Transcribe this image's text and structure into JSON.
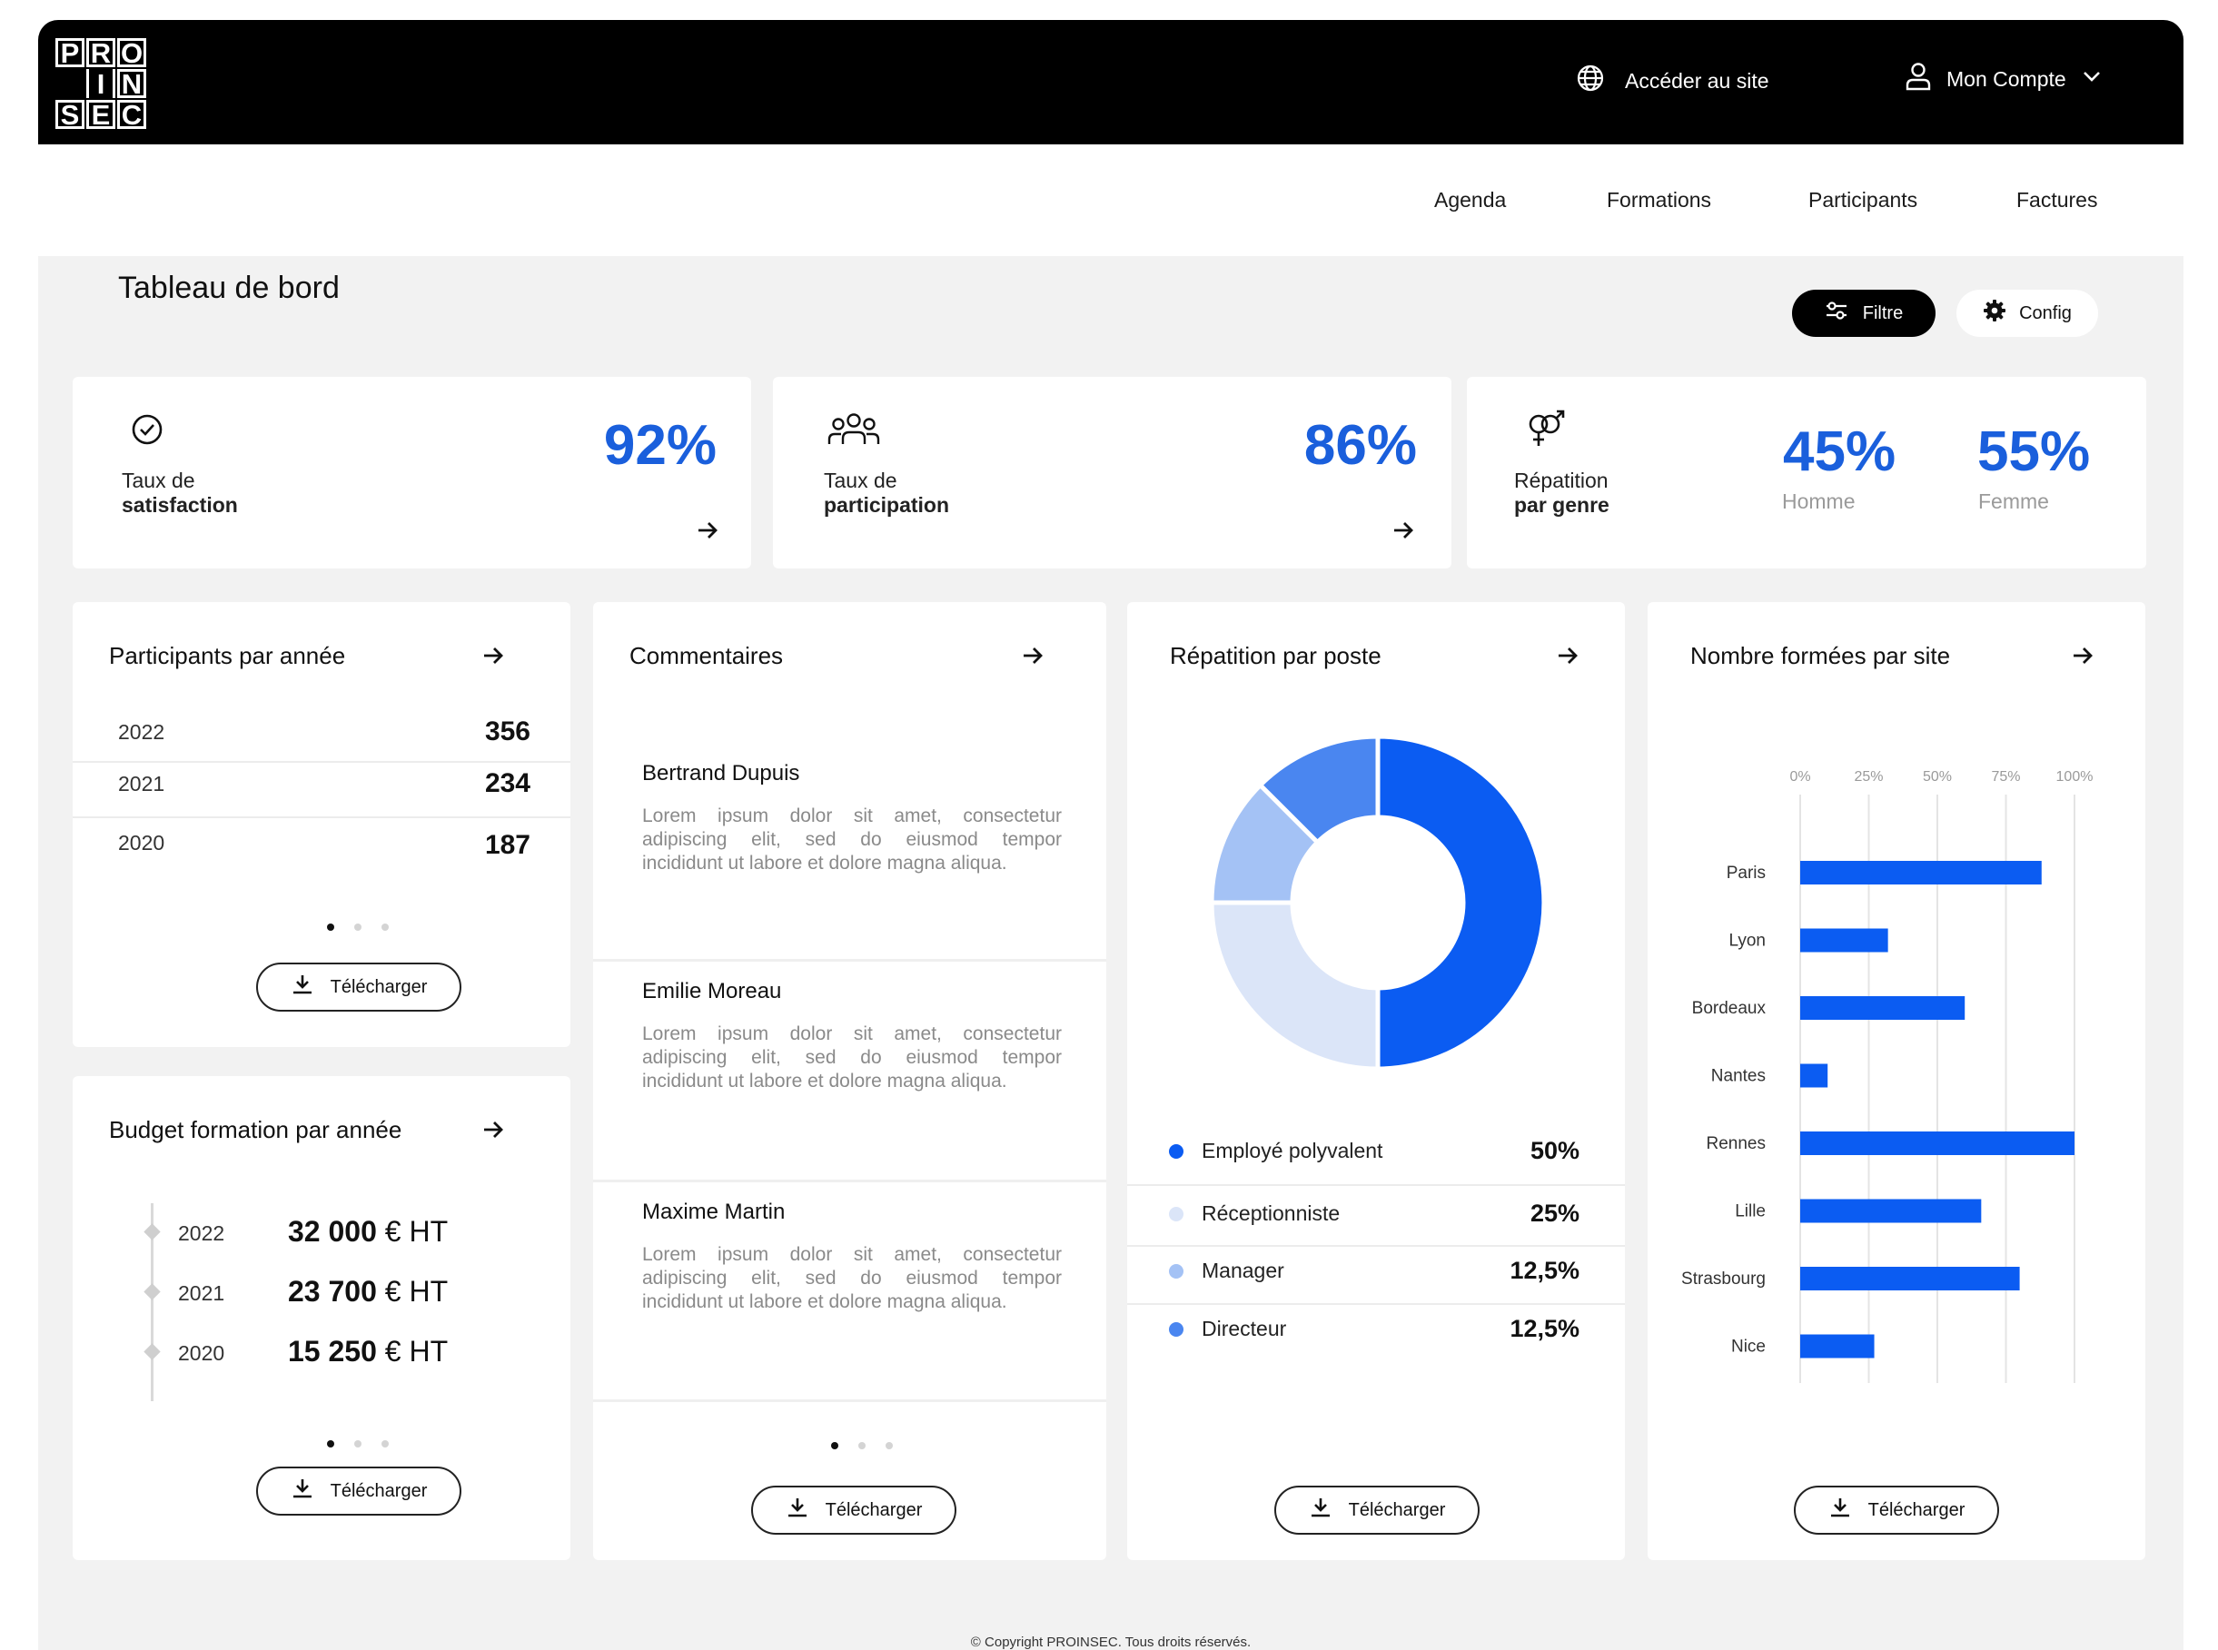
{
  "header": {
    "logo": [
      "P",
      "R",
      "O",
      "",
      "I",
      "N",
      "S",
      "E",
      "C"
    ],
    "site_link": "Accéder au site",
    "account": "Mon Compte"
  },
  "nav": [
    "Agenda",
    "Formations",
    "Participants",
    "Factures"
  ],
  "page": {
    "title": "Tableau de bord",
    "filter_label": "Filtre",
    "config_label": "Config"
  },
  "kpis": {
    "satisfaction": {
      "line1": "Taux de",
      "line2": "satisfaction",
      "value": "92%"
    },
    "participation": {
      "line1": "Taux de",
      "line2": "participation",
      "value": "86%"
    },
    "genre": {
      "line1": "Répatition",
      "line2": "par genre",
      "homme_value": "45%",
      "homme_label": "Homme",
      "femme_value": "55%",
      "femme_label": "Femme"
    }
  },
  "participants": {
    "title": "Participants par année",
    "rows": [
      {
        "year": "2022",
        "count": "356"
      },
      {
        "year": "2021",
        "count": "234"
      },
      {
        "year": "2020",
        "count": "187"
      }
    ],
    "download": "Télécharger"
  },
  "budget": {
    "title": "Budget formation par année",
    "rows": [
      {
        "year": "2022",
        "amount": "32 000",
        "unit": " € HT"
      },
      {
        "year": "2021",
        "amount": "23 700",
        "unit": " € HT"
      },
      {
        "year": "2020",
        "amount": "15 250",
        "unit": " € HT"
      }
    ],
    "download": "Télécharger"
  },
  "comments": {
    "title": "Commentaires",
    "items": [
      {
        "name": "Bertrand Dupuis",
        "lines": [
          "Lorem ipsum dolor sit amet, consectetur",
          "adipiscing elit, sed do eiusmod tempor",
          "incididunt ut labore et dolore magna aliqua."
        ]
      },
      {
        "name": "Emilie Moreau",
        "lines": [
          "Lorem ipsum dolor sit amet, consectetur",
          "adipiscing elit, sed do eiusmod tempor",
          "incididunt ut labore et dolore magna aliqua."
        ]
      },
      {
        "name": "Maxime Martin",
        "lines": [
          "Lorem ipsum dolor sit amet, consectetur",
          "adipiscing elit, sed do eiusmod tempor",
          "incididunt ut labore et dolore magna aliqua."
        ]
      }
    ],
    "download": "Télécharger"
  },
  "poste": {
    "title": "Répatition par poste",
    "legend": [
      {
        "label": "Employé polyvalent",
        "value": "50%"
      },
      {
        "label": "Réceptionniste",
        "value": "25%"
      },
      {
        "label": "Manager",
        "value": "12,5%"
      },
      {
        "label": "Directeur",
        "value": "12,5%"
      }
    ],
    "download": "Télécharger"
  },
  "sites": {
    "title": "Nombre formées par site",
    "download": "Télécharger"
  },
  "colors": {
    "accent": "#1a5fdc",
    "bar_blue": "#0b5cf2",
    "donut": [
      "#0b5cf2",
      "#dbe5f8",
      "#a4c2f5",
      "#4a86f0"
    ]
  },
  "chart_data": [
    {
      "type": "pie",
      "title": "Répatition par poste",
      "categories": [
        "Employé polyvalent",
        "Réceptionniste",
        "Manager",
        "Directeur"
      ],
      "values": [
        50,
        25,
        12.5,
        12.5
      ],
      "colors": [
        "#0b5cf2",
        "#dbe5f8",
        "#a4c2f5",
        "#4a86f0"
      ],
      "donut": true,
      "legend": "bottom"
    },
    {
      "type": "bar",
      "orientation": "horizontal",
      "title": "Nombre formées par site",
      "categories": [
        "Paris",
        "Lyon",
        "Bordeaux",
        "Nantes",
        "Rennes",
        "Lille",
        "Strasbourg",
        "Nice"
      ],
      "values": [
        88,
        32,
        60,
        10,
        100,
        66,
        80,
        27
      ],
      "unit": "%",
      "xticks": [
        "0%",
        "25%",
        "50%",
        "75%",
        "100%"
      ],
      "xlim": [
        0,
        100
      ],
      "grid": true,
      "color": "#0b5cf2"
    }
  ],
  "footer": "© Copyright PROINSEC. Tous droits réservés."
}
